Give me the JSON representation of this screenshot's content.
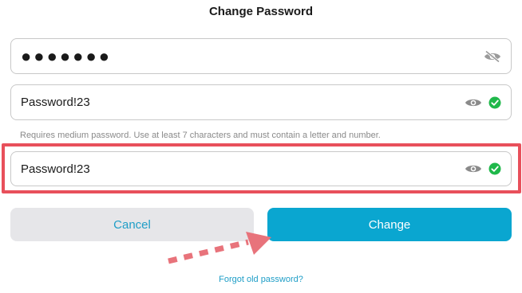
{
  "title": "Change Password",
  "current_password": {
    "value": "●●●●●●●",
    "visibility_icon": "eye-off-icon"
  },
  "new_password": {
    "value": "Password!23",
    "visibility_icon": "eye-icon",
    "status_icon": "check-circle-icon"
  },
  "hint": "Requires medium password. Use at least 7 characters and must contain a letter and number.",
  "confirm_password": {
    "value": "Password!23",
    "visibility_icon": "eye-icon",
    "status_icon": "check-circle-icon"
  },
  "buttons": {
    "cancel": "Cancel",
    "change": "Change"
  },
  "forgot_link": "Forgot old password?",
  "colors": {
    "accent": "#0aa6d0",
    "link": "#1f9ec7",
    "success": "#1fb84a",
    "highlight": "#e8505b",
    "cancel_bg": "#e6e6e9"
  }
}
